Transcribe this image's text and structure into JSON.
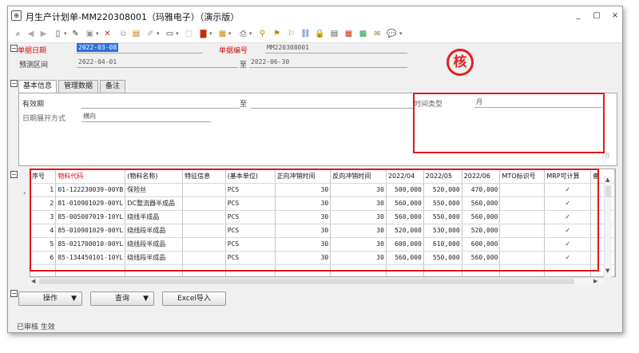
{
  "window": {
    "title": "月生产计划单-MM220308001（玛雅电子）（演示版）",
    "minimize": "_",
    "maximize": "□",
    "close": "×"
  },
  "toolbar": {
    "icons": [
      "preview-icon",
      "back-icon",
      "forward-icon",
      "new-icon",
      "edit-icon",
      "save-icon",
      "delete-icon",
      "copy-icon",
      "paste-icon",
      "attach-icon",
      "print-setup-icon",
      "page-icon",
      "book-icon",
      "export-icon",
      "printer-icon",
      "find-icon",
      "audit-icon",
      "unaudit-icon",
      "link-icon",
      "lock-icon",
      "calc-icon",
      "grid-icon",
      "excel-icon",
      "mail-icon",
      "chat-icon"
    ]
  },
  "header": {
    "date_label": "单据日期",
    "date_value": "2022-03-08",
    "doc_no_label": "单据编号",
    "doc_no_value": "MM220308001",
    "forecast_label": "预测区间",
    "forecast_from": "2022-04-01",
    "forecast_to_label": "至",
    "forecast_to": "2022-06-30",
    "stamp_text": "核"
  },
  "tabs": [
    {
      "label": "基本信息"
    },
    {
      "label": "管理数据"
    },
    {
      "label": "备注"
    }
  ],
  "panel": {
    "validity_label": "有效期",
    "validity_to_label": "至",
    "expand_label": "日期展开方式",
    "expand_value": "横向",
    "time_type_label": "时间类型",
    "time_type_value": "月",
    "corner_mark": "78"
  },
  "grid": {
    "columns": [
      "序号",
      "物料代码",
      "(物料名称)",
      "特征信息",
      "(基本单位)",
      "正向冲销时间",
      "反向冲销时间",
      "2022/04",
      "2022/05",
      "2022/06",
      "MTO标识号",
      "MRP可计算",
      "备"
    ],
    "rows": [
      [
        "1",
        "01-122230039-00YB",
        "保险丝",
        "",
        "PCS",
        "30",
        "30",
        "500,000",
        "520,000",
        "470,000",
        "",
        "✓"
      ],
      [
        "2",
        "81-010901029-00YL",
        "DC整流器半成品",
        "",
        "PCS",
        "30",
        "30",
        "560,000",
        "550,000",
        "560,000",
        "",
        "✓"
      ],
      [
        "3",
        "85-005007019-10YL",
        "绕线半成品",
        "",
        "PCS",
        "30",
        "30",
        "560,000",
        "550,000",
        "560,000",
        "",
        "✓"
      ],
      [
        "4",
        "85-010901029-00YL",
        "绕线段半成品",
        "",
        "PCS",
        "30",
        "30",
        "520,000",
        "530,000",
        "520,000",
        "",
        "✓"
      ],
      [
        "5",
        "85-021700010-00YL",
        "绕线段半成品",
        "",
        "PCS",
        "30",
        "30",
        "600,000",
        "610,000",
        "600,000",
        "",
        "✓"
      ],
      [
        "6",
        "85-134450101-10YL",
        "绕线段半成品",
        "",
        "PCS",
        "30",
        "30",
        "560,000",
        "550,000",
        "560,000",
        "",
        "✓"
      ]
    ]
  },
  "buttons": {
    "operate": "操作",
    "query": "查询",
    "excel_import": "Excel导入"
  },
  "status": "已审核 生效"
}
